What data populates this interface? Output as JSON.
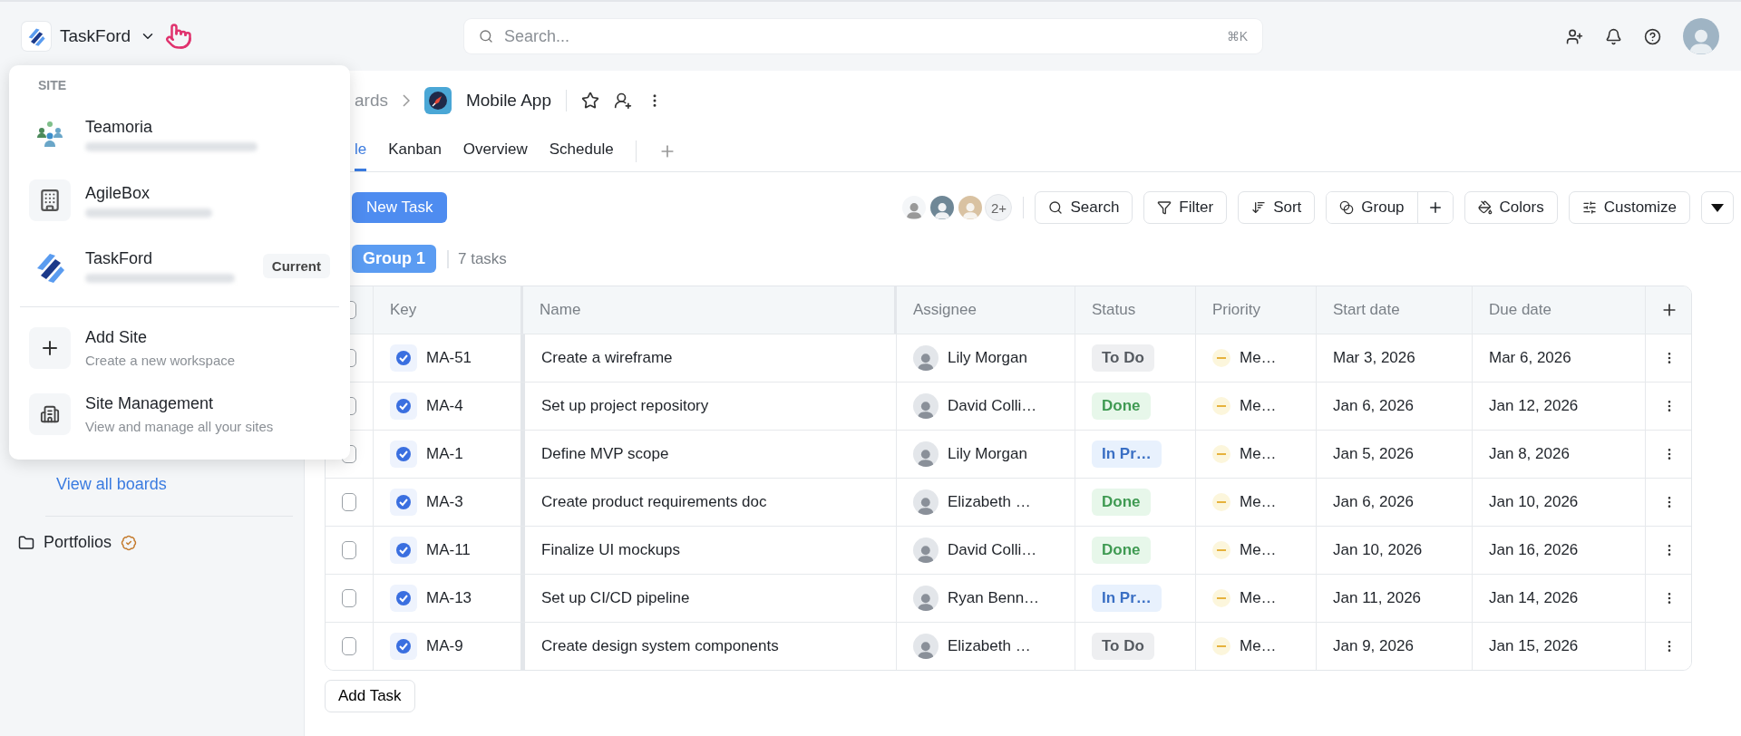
{
  "topbar": {
    "workspace": "TaskFord",
    "search": {
      "placeholder": "Search...",
      "shortcut": "⌘K"
    }
  },
  "site_menu": {
    "heading": "SITE",
    "sites": [
      {
        "kind": "team",
        "name": "Teamoria"
      },
      {
        "kind": "building",
        "name": "AgileBox"
      },
      {
        "kind": "logo",
        "name": "TaskFord",
        "badge": "Current"
      }
    ],
    "actions": [
      {
        "kind": "add",
        "title": "Add Site",
        "subtitle": "Create a new workspace"
      },
      {
        "kind": "manage",
        "title": "Site Management",
        "subtitle": "View and manage all your sites"
      }
    ]
  },
  "sidebar": {
    "link": "View all boards",
    "items": [
      {
        "label": "Portfolios"
      }
    ]
  },
  "breadcrumb": {
    "parent": "ards",
    "board": "Mobile App"
  },
  "tabs": [
    {
      "label": "le",
      "selected": true
    },
    {
      "label": "Kanban",
      "selected": false
    },
    {
      "label": "Overview",
      "selected": false
    },
    {
      "label": "Schedule",
      "selected": false
    }
  ],
  "toolbar": {
    "new_task": "New Task",
    "member_count": "2+",
    "buttons": [
      {
        "kind": "search",
        "label": "Search"
      },
      {
        "kind": "filter",
        "label": "Filter"
      },
      {
        "kind": "sort",
        "label": "Sort"
      },
      {
        "kind": "group",
        "label": "Group"
      },
      {
        "kind": "colors",
        "label": "Colors"
      },
      {
        "kind": "customize",
        "label": "Customize"
      }
    ]
  },
  "group": {
    "name": "Group 1",
    "count": "7 tasks"
  },
  "table": {
    "header_checked": false,
    "columns": [
      "Key",
      "Name",
      "Assignee",
      "Status",
      "Priority",
      "Start date",
      "Due date"
    ],
    "rows": [
      {
        "checked": false,
        "key": "MA-51",
        "name": "Create a wireframe",
        "assignee": "Lily Morgan",
        "status": {
          "label": "To Do",
          "kind": "todo"
        },
        "priority": "Me…",
        "start": "Mar 3, 2026",
        "due": "Mar 6, 2026"
      },
      {
        "checked": false,
        "key": "MA-4",
        "name": "Set up project repository",
        "assignee": "David Colli…",
        "status": {
          "label": "Done",
          "kind": "done"
        },
        "priority": "Me…",
        "start": "Jan 6, 2026",
        "due": "Jan 12, 2026"
      },
      {
        "checked": false,
        "key": "MA-1",
        "name": "Define MVP scope",
        "assignee": "Lily Morgan",
        "status": {
          "label": "In Pr…",
          "kind": "in_progress"
        },
        "priority": "Me…",
        "start": "Jan 5, 2026",
        "due": "Jan 8, 2026"
      },
      {
        "checked": false,
        "key": "MA-3",
        "name": "Create product requirements doc",
        "assignee": "Elizabeth …",
        "status": {
          "label": "Done",
          "kind": "done"
        },
        "priority": "Me…",
        "start": "Jan 6, 2026",
        "due": "Jan 10, 2026"
      },
      {
        "checked": false,
        "key": "MA-11",
        "name": "Finalize UI mockups",
        "assignee": "David Colli…",
        "status": {
          "label": "Done",
          "kind": "done"
        },
        "priority": "Me…",
        "start": "Jan 10, 2026",
        "due": "Jan 16, 2026"
      },
      {
        "checked": false,
        "key": "MA-13",
        "name": "Set up CI/CD pipeline",
        "assignee": "Ryan Benn…",
        "status": {
          "label": "In Pr…",
          "kind": "in_progress"
        },
        "priority": "Me…",
        "start": "Jan 11, 2026",
        "due": "Jan 14, 2026"
      },
      {
        "checked": false,
        "key": "MA-9",
        "name": "Create design system components",
        "assignee": "Elizabeth …",
        "status": {
          "label": "To Do",
          "kind": "todo"
        },
        "priority": "Me…",
        "start": "Jan 9, 2026",
        "due": "Jan 15, 2026"
      }
    ],
    "add_task": "Add Task"
  }
}
